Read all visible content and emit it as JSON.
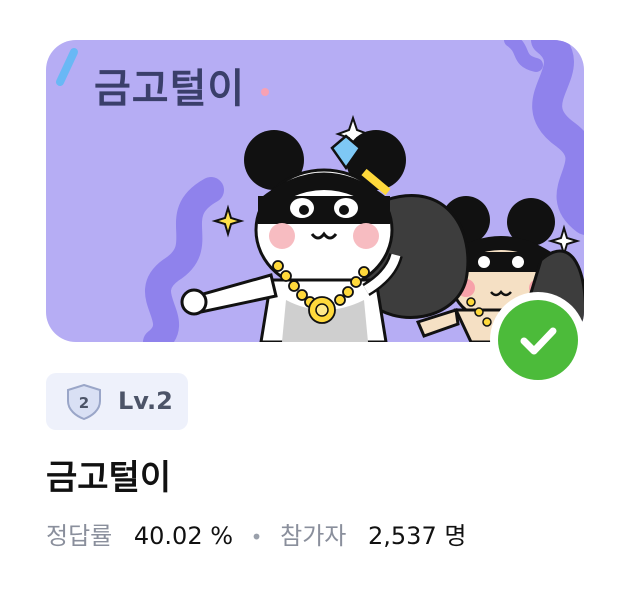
{
  "banner": {
    "title": "금고털이",
    "background_color": "#b6adf4",
    "illustration": "two cartoon mouse thieves with diamond and gold chain"
  },
  "completed_badge": {
    "icon": "check-icon",
    "color": "#4cbb3a"
  },
  "level": {
    "badge_number": "2",
    "label": "Lv.2",
    "icon": "shield-icon"
  },
  "quiz": {
    "title": "금고털이"
  },
  "stats": {
    "accuracy_label": "정답률",
    "accuracy_value": "40.02 %",
    "separator": "•",
    "participants_label": "참가자",
    "participants_value": "2,537 명"
  }
}
